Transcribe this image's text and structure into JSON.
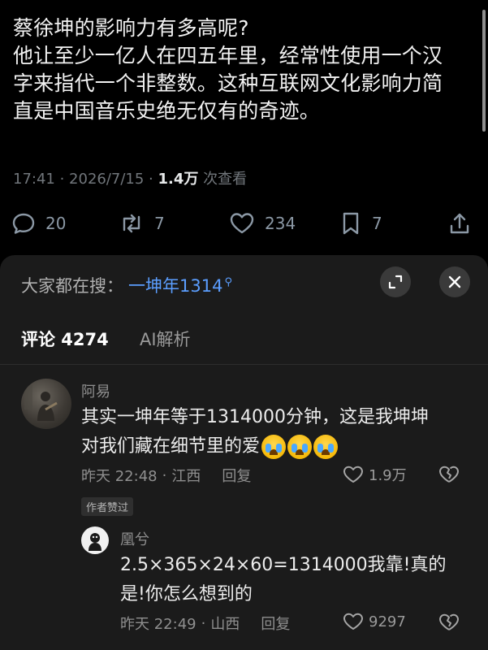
{
  "post": {
    "lines": [
      "蔡徐坤的影响力有多高呢?",
      "他让至少一亿人在四五年里，经常性使用一个汉",
      "字来指代一个非整数。这种互联网文化影响力简",
      "直是中国音乐史绝无仅有的奇迹。"
    ],
    "time_date": "17:41 · 2026/7/15 ·",
    "views_count": "1.4万",
    "views_label": "次查看",
    "replies": "20",
    "reposts": "7",
    "likes": "234",
    "bookmarks": "7"
  },
  "sheet": {
    "search_prefix": "大家都在搜：",
    "search_keyword": "一坤年1314",
    "tabs": [
      "评论 4274",
      "AI解析"
    ]
  },
  "comments": [
    {
      "name": "阿易",
      "line1": "其实一坤年等于1314000分钟，这是我坤坤",
      "line2": "对我们藏在细节里的爱",
      "time": "昨天 22:48",
      "location": "江西",
      "reply": "回复",
      "likes": "1.9万",
      "badge": "作者赞过"
    },
    {
      "name": "凰兮",
      "line1": "2.5×365×24×60=1314000我靠!真的",
      "line2": "是!你怎么想到的",
      "time": "昨天 22:49",
      "location": "山西",
      "reply": "回复",
      "likes": "9297"
    }
  ],
  "icons": {
    "reply": "speech-bubble-icon",
    "repost": "repost-arrows-icon",
    "like": "heart-icon",
    "bookmark": "bookmark-icon",
    "share": "share-icon",
    "expand": "expand-icon",
    "close": "close-icon",
    "dislike": "broken-heart-icon",
    "emoji": "crying-face-emoji"
  },
  "colors": {
    "background": "#000000",
    "sheet": "#1b1b1b",
    "link": "#5b9eff",
    "muted": "#71767b"
  }
}
